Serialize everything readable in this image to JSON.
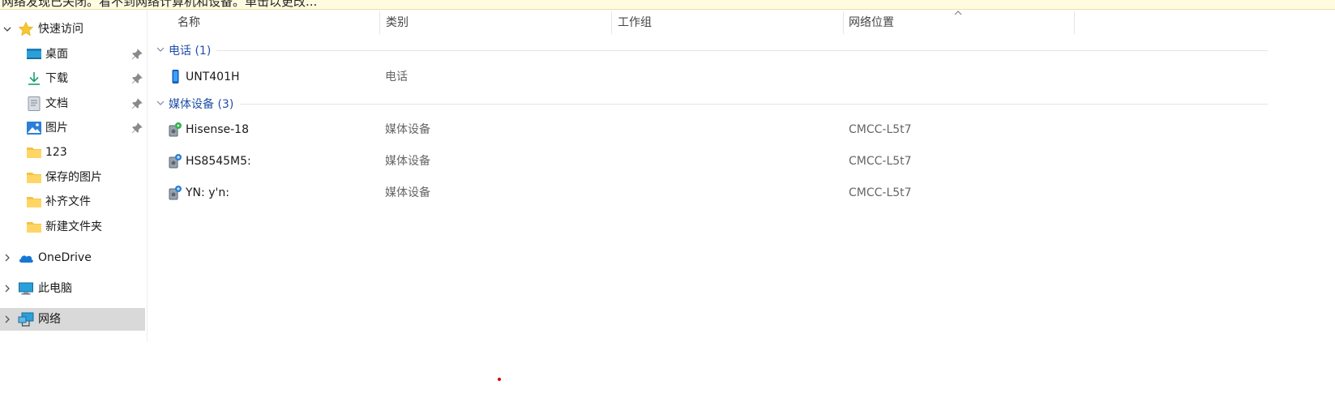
{
  "infobar": {
    "text": "网络发现已关闭。看不到网络计算机和设备。单击以更改..."
  },
  "sidebar": {
    "quick_access": {
      "label": "快速访问"
    },
    "items": [
      {
        "label": "桌面",
        "icon": "desktop-icon",
        "pinned": true
      },
      {
        "label": "下载",
        "icon": "download-icon",
        "pinned": true
      },
      {
        "label": "文档",
        "icon": "document-icon",
        "pinned": true
      },
      {
        "label": "图片",
        "icon": "pictures-icon",
        "pinned": true
      },
      {
        "label": "123",
        "icon": "folder-icon",
        "pinned": false
      },
      {
        "label": "保存的图片",
        "icon": "folder-icon",
        "pinned": false
      },
      {
        "label": "补齐文件",
        "icon": "folder-icon",
        "pinned": false
      },
      {
        "label": "新建文件夹",
        "icon": "folder-icon",
        "pinned": false
      }
    ],
    "onedrive": {
      "label": "OneDrive"
    },
    "thispc": {
      "label": "此电脑"
    },
    "network": {
      "label": "网络"
    }
  },
  "columns": {
    "name": "名称",
    "category": "类别",
    "workgroup": "工作组",
    "location": "网络位置"
  },
  "groups": [
    {
      "label": "电话 (1)",
      "rows": [
        {
          "name": "UNT401H",
          "category": "电话",
          "location": ""
        }
      ]
    },
    {
      "label": "媒体设备 (3)",
      "rows": [
        {
          "name": "Hisense-18",
          "category": "媒体设备",
          "location": "CMCC-L5t7"
        },
        {
          "name": "HS8545M5:",
          "category": "媒体设备",
          "location": "CMCC-L5t7"
        },
        {
          "name": "YN: y'n:",
          "category": "媒体设备",
          "location": "CMCC-L5t7"
        }
      ]
    }
  ],
  "colors": {
    "accent": "#1f4fa8",
    "selected_bg": "#d9d9d9",
    "infobar_bg": "#fffbe0",
    "folder": "#f5c242"
  }
}
